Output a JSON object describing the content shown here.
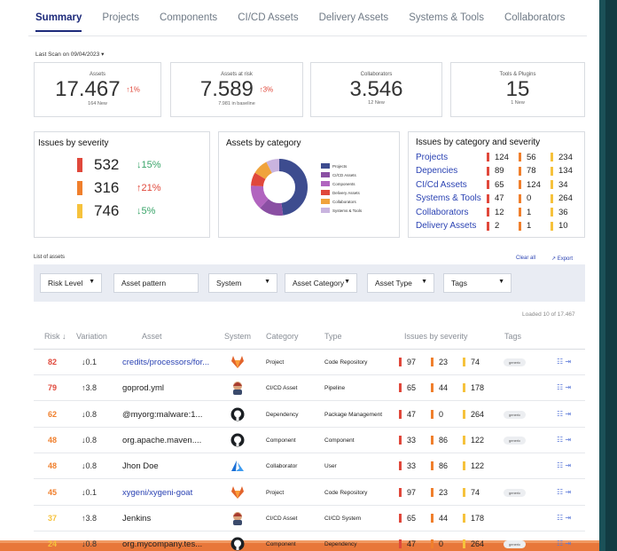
{
  "tabs": [
    "Summary",
    "Projects",
    "Components",
    "CI/CD Assets",
    "Delivery Assets",
    "Systems & Tools",
    "Collaborators"
  ],
  "last_scan": "Last Scan on 09/04/2023 ▾",
  "kpis": [
    {
      "label": "Assets",
      "value": "17.467",
      "delta": "↑1%",
      "sub": "164 New"
    },
    {
      "label": "Assets at risk",
      "value": "7.589",
      "delta": "↑3%",
      "sub": "7.981 in baseline"
    },
    {
      "label": "Collaborators",
      "value": "3.546",
      "delta": "",
      "sub": "12 New"
    },
    {
      "label": "Tools & Plugins",
      "value": "15",
      "delta": "",
      "sub": "1 New"
    }
  ],
  "severity": {
    "title": "Issues by severity",
    "rows": [
      {
        "value": "532",
        "delta": "↓15%",
        "color": "#e0483b",
        "delta_color": "#3aa56a"
      },
      {
        "value": "316",
        "delta": "↑21%",
        "color": "#f07f2c",
        "delta_color": "#e0483b"
      },
      {
        "value": "746",
        "delta": "↓5%",
        "color": "#f6c23c",
        "delta_color": "#3aa56a"
      }
    ]
  },
  "category": {
    "title": "Assets by category",
    "legend": [
      {
        "label": "Projects",
        "color": "#3d4c8f"
      },
      {
        "label": "CI/CD Assets",
        "color": "#8a4fa3"
      },
      {
        "label": "Components",
        "color": "#b164bf"
      },
      {
        "label": "Delivery Assets",
        "color": "#e0483b"
      },
      {
        "label": "Collaborators",
        "color": "#f0a33c"
      },
      {
        "label": "Systems & Tools",
        "color": "#c9b4df"
      }
    ]
  },
  "cat_sev": {
    "title": "Issues by category and severity",
    "rows": [
      {
        "name": "Projects",
        "a": "124",
        "b": "56",
        "c": "234"
      },
      {
        "name": "Depencies",
        "a": "89",
        "b": "78",
        "c": "134"
      },
      {
        "name": "CI/Cd Assets",
        "a": "65",
        "b": "124",
        "c": "34"
      },
      {
        "name": "Systems & Tools",
        "a": "47",
        "b": "0",
        "c": "264"
      },
      {
        "name": "Collaborators",
        "a": "12",
        "b": "1",
        "c": "36"
      },
      {
        "name": "Delivery Assets",
        "a": "2",
        "b": "1",
        "c": "10"
      }
    ]
  },
  "list": {
    "title": "List of assets",
    "clear_all": "Clear all",
    "export": "↗ Export",
    "loaded": "Loaded 10 of 17.467"
  },
  "filters": {
    "risk": "Risk Level",
    "pattern": "Asset pattern",
    "system": "System",
    "category": "Asset Category",
    "type": "Asset Type",
    "tags": "Tags"
  },
  "columns": {
    "risk": "Risk ↓",
    "variation": "Variation",
    "asset": "Asset",
    "system": "System",
    "category": "Category",
    "type": "Type",
    "issues": "Issues by severity",
    "tags": "Tags"
  },
  "rows": [
    {
      "risk": "82",
      "risk_color": "#e0483b",
      "var": "↓0.1",
      "asset": "credits/processors/for...",
      "link": true,
      "sys": "gitlab",
      "cat": "Project",
      "type": "Code Repository",
      "i": [
        "97",
        "23",
        "74"
      ],
      "tag": "generic"
    },
    {
      "risk": "79",
      "risk_color": "#e0483b",
      "var": "↑3.8",
      "asset": "goprod.yml",
      "link": false,
      "sys": "jenkins",
      "cat": "CI/CD Asset",
      "type": "Pipeline",
      "i": [
        "65",
        "44",
        "178"
      ],
      "tag": ""
    },
    {
      "risk": "62",
      "risk_color": "#f07f2c",
      "var": "↓0.8",
      "asset": "@myorg:malware:1...",
      "link": false,
      "sys": "github",
      "cat": "Dependency",
      "type": "Package Management",
      "i": [
        "47",
        "0",
        "264"
      ],
      "tag": "generic"
    },
    {
      "risk": "48",
      "risk_color": "#f07f2c",
      "var": "↓0.8",
      "asset": "org.apache.maven....",
      "link": false,
      "sys": "github",
      "cat": "Component",
      "type": "Component",
      "i": [
        "33",
        "86",
        "122"
      ],
      "tag": "generic"
    },
    {
      "risk": "48",
      "risk_color": "#f07f2c",
      "var": "↓0.8",
      "asset": "Jhon Doe",
      "link": false,
      "sys": "azure",
      "cat": "Collaborator",
      "type": "User",
      "i": [
        "33",
        "86",
        "122"
      ],
      "tag": ""
    },
    {
      "risk": "45",
      "risk_color": "#f07f2c",
      "var": "↓0.1",
      "asset": "xygeni/xygeni-goat",
      "link": true,
      "sys": "gitlab",
      "cat": "Project",
      "type": "Code Repository",
      "i": [
        "97",
        "23",
        "74"
      ],
      "tag": "generic"
    },
    {
      "risk": "37",
      "risk_color": "#f6c23c",
      "var": "↑3.8",
      "asset": "Jenkins",
      "link": false,
      "sys": "jenkins",
      "cat": "CI/CD Asset",
      "type": "CI/CD System",
      "i": [
        "65",
        "44",
        "178"
      ],
      "tag": ""
    },
    {
      "risk": "24",
      "risk_color": "#f6c23c",
      "var": "↓0.8",
      "asset": "org.mycompany.tes...",
      "link": false,
      "sys": "github",
      "cat": "Component",
      "type": "Dependency",
      "i": [
        "47",
        "0",
        "264"
      ],
      "tag": "generic"
    }
  ],
  "severity_colors": [
    "#e0483b",
    "#f07f2c",
    "#f6c23c"
  ]
}
